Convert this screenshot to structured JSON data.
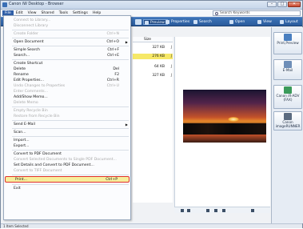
{
  "window": {
    "title": "Canon iW Desktop - Browser",
    "controls": [
      "–",
      "□",
      "✕"
    ]
  },
  "menubar": [
    "File",
    "Edit",
    "View",
    "Shared",
    "Tools",
    "Settings",
    "Help"
  ],
  "search": {
    "placeholder": "Search Keywords"
  },
  "toolbar": {
    "preview": "Preview",
    "properties": "Properties",
    "search": "Search",
    "open": "Open",
    "view": "View",
    "layout": "Layout"
  },
  "list": {
    "header": "Size",
    "rows": [
      {
        "size": "327 KB",
        "letter": "J",
        "selected": false
      },
      {
        "size": "276 KB",
        "letter": "J",
        "selected": true
      },
      {
        "size": "64 KB",
        "letter": "J",
        "selected": false
      },
      {
        "size": "327 KB",
        "letter": "J",
        "selected": false
      }
    ]
  },
  "right_panel": {
    "tiles": [
      "Print,Preview",
      "E-Mail",
      "Canon iR-ADV (FAX)",
      "Canon imageRUNNER"
    ]
  },
  "bottom_status": "1 Item Selected",
  "file_menu": {
    "items": [
      {
        "label": "Connect to Library...",
        "shortcut": "",
        "disabled": true
      },
      {
        "label": "Disconnect Library",
        "shortcut": "",
        "disabled": true
      },
      {
        "sep": true
      },
      {
        "label": "Create Folder",
        "shortcut": "Ctrl+N",
        "disabled": true
      },
      {
        "sep": true
      },
      {
        "label": "Open Document",
        "shortcut": "Ctrl+O",
        "disabled": false,
        "arrow": true
      },
      {
        "sep": true
      },
      {
        "label": "Simple Search",
        "shortcut": "Ctrl+F",
        "disabled": false
      },
      {
        "label": "Search...",
        "shortcut": "Ctrl+E",
        "disabled": false
      },
      {
        "sep": true
      },
      {
        "label": "Create Shortcut",
        "shortcut": "",
        "disabled": false
      },
      {
        "label": "Delete",
        "shortcut": "Del",
        "disabled": false
      },
      {
        "label": "Rename",
        "shortcut": "F2",
        "disabled": false
      },
      {
        "label": "Edit Properties...",
        "shortcut": "Ctrl+R",
        "disabled": false
      },
      {
        "label": "Undo Changes to Properties",
        "shortcut": "Ctrl+U",
        "disabled": true
      },
      {
        "label": "Enter Comments...",
        "shortcut": "",
        "disabled": true
      },
      {
        "label": "Add/Show Memo...",
        "shortcut": "",
        "disabled": false
      },
      {
        "label": "Delete Memo",
        "shortcut": "",
        "disabled": true
      },
      {
        "sep": true
      },
      {
        "label": "Empty Recycle Bin",
        "shortcut": "",
        "disabled": true
      },
      {
        "label": "Restore from Recycle Bin",
        "shortcut": "",
        "disabled": true
      },
      {
        "sep": true
      },
      {
        "label": "Send E-Mail",
        "shortcut": "",
        "disabled": false,
        "arrow": true
      },
      {
        "sep": true
      },
      {
        "label": "Scan...",
        "shortcut": "",
        "disabled": false
      },
      {
        "sep": true
      },
      {
        "label": "Import...",
        "shortcut": "",
        "disabled": false
      },
      {
        "label": "Export...",
        "shortcut": "",
        "disabled": false
      },
      {
        "sep": true
      },
      {
        "label": "Convert to PDF Document",
        "shortcut": "",
        "disabled": false
      },
      {
        "label": "Convert Selected Documents to Single PDF Document...",
        "shortcut": "",
        "disabled": true
      },
      {
        "label": "Set Details and Convert to PDF Document...",
        "shortcut": "",
        "disabled": false
      },
      {
        "label": "Convert to TIFF Document",
        "shortcut": "",
        "disabled": true
      },
      {
        "sep": true
      },
      {
        "label": "Print...",
        "shortcut": "Ctrl+P",
        "disabled": false,
        "highlight": true
      },
      {
        "sep": true
      },
      {
        "label": "Exit",
        "shortcut": "",
        "disabled": false
      }
    ]
  }
}
